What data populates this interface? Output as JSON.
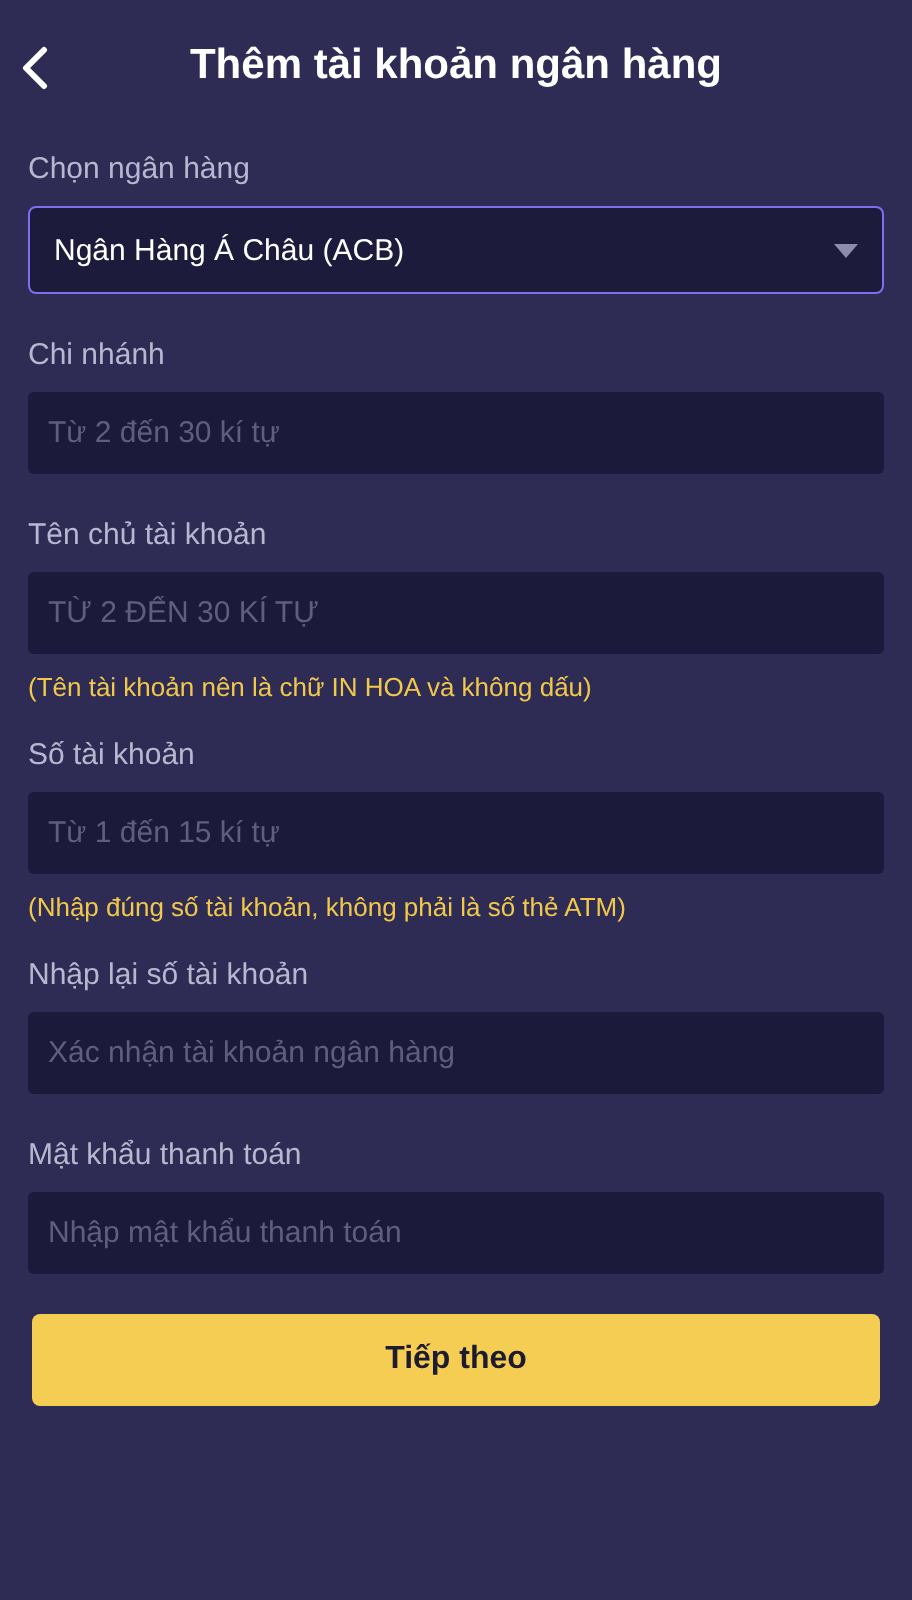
{
  "header": {
    "title": "Thêm tài khoản ngân hàng"
  },
  "fields": [
    {
      "kind": "select",
      "label": "Chọn ngân hàng",
      "value": "Ngân Hàng Á Châu (ACB)"
    },
    {
      "kind": "input",
      "label": "Chi nhánh",
      "placeholder": "Từ 2 đến 30 kí tự"
    },
    {
      "kind": "input",
      "label": "Tên chủ tài khoản",
      "placeholder": "TỪ 2 ĐẾN 30 KÍ TỰ",
      "note": "(Tên tài khoản nên là chữ IN HOA và không dấu)"
    },
    {
      "kind": "input",
      "label": "Số tài khoản",
      "placeholder": "Từ 1 đến 15 kí tự",
      "note": "(Nhập đúng số tài khoản, không phải là số thẻ ATM)"
    },
    {
      "kind": "input",
      "label": "Nhập lại số tài khoản",
      "placeholder": "Xác nhận tài khoản ngân hàng"
    },
    {
      "kind": "input",
      "label": "Mật khẩu thanh toán",
      "placeholder": "Nhập mật khẩu thanh toán"
    }
  ],
  "submit_button": "Tiếp theo"
}
